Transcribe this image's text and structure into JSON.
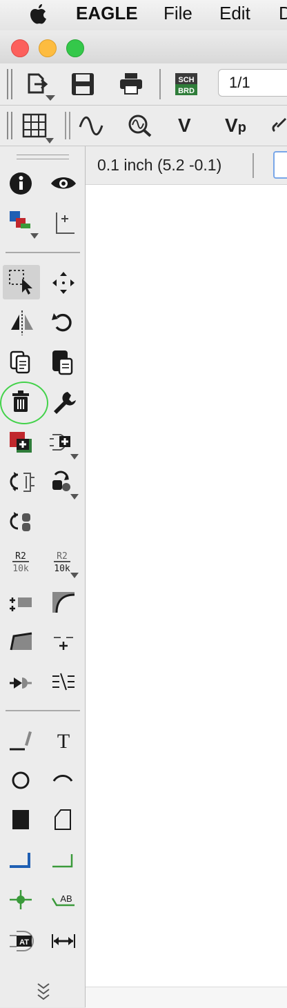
{
  "menubar": {
    "apple_icon": "apple-icon",
    "app_name": "EAGLE",
    "items": [
      "File",
      "Edit",
      "D"
    ]
  },
  "toolbar": {
    "sheet_value": "1/1",
    "sch_brd_top": "SCH",
    "sch_brd_bottom": "BRD",
    "icons_row1": [
      "open-icon",
      "save-icon",
      "print-icon",
      "sch-brd-switch-icon"
    ],
    "icons_row2": [
      "grid-icon",
      "signal-icon",
      "zoom-fit-icon",
      "value-icon",
      "voltage-icon",
      "link-icon"
    ],
    "value_letter": "V",
    "voltage_letter": "V",
    "voltage_sub": "p"
  },
  "status": {
    "coordinates": "0.1 inch (5.2 -0.1)"
  },
  "palette": {
    "icons": [
      "info-icon",
      "show-icon",
      "layers-icon",
      "mark-icon",
      "select-icon",
      "move-icon",
      "mirror-icon",
      "rotate-icon",
      "copy-icon",
      "paste-icon",
      "delete-icon",
      "change-icon",
      "add-icon",
      "invoke-icon",
      "replace-icon",
      "gateswap-icon",
      "pinswap-icon",
      "name-icon",
      "value-icon",
      "split-icon",
      "miter-icon",
      "slice-icon",
      "join-icon",
      "attribute-icon",
      "bus-break-icon",
      "wire-icon",
      "text-icon",
      "circle-icon",
      "arc-icon",
      "rect-icon",
      "polygon-icon",
      "bus-icon",
      "net-icon",
      "junction-icon",
      "label-icon",
      "frame-icon",
      "dimension-icon",
      "more-icon"
    ],
    "name_label_top": "R2",
    "name_label_bottom": "10k",
    "value_label_top": "R2",
    "value_label_bottom": "10k",
    "text_tool_glyph": "T",
    "label_tool_text": "AB",
    "attribute_tool_text": "AT",
    "selected_tool": "select",
    "highlighted_tool": "delete"
  },
  "colors": {
    "highlight_ring": "#43d24a",
    "net_green": "#3a9a3a",
    "bus_blue": "#1f5fb3",
    "layer_red": "#c0272d"
  }
}
